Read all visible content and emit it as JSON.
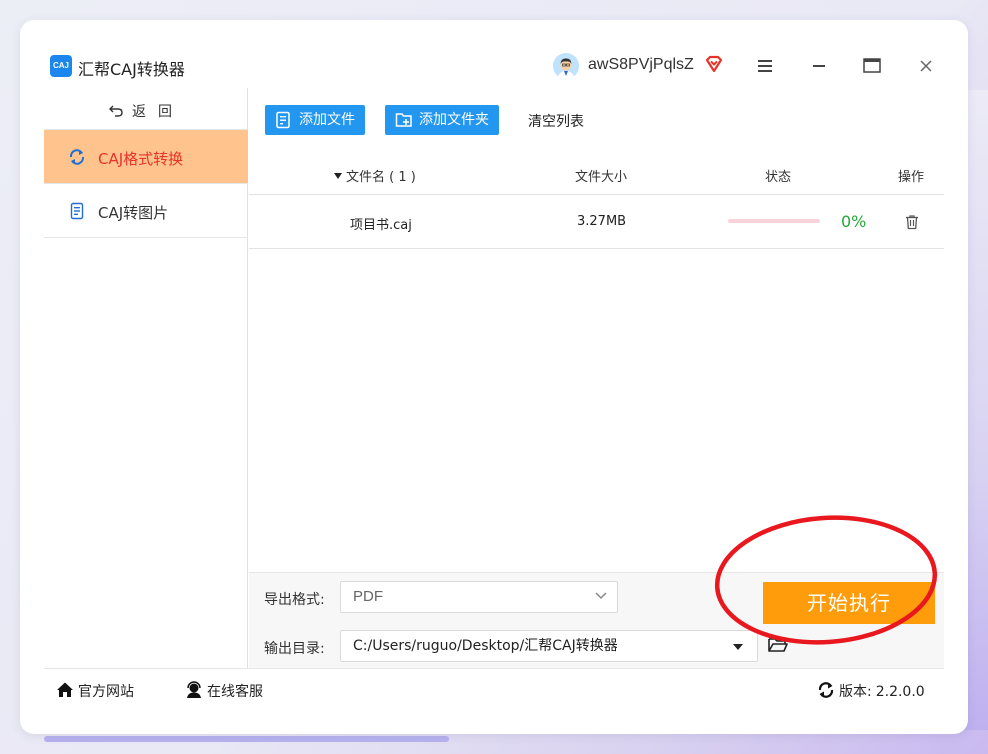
{
  "window": {
    "title": "汇帮CAJ转换器",
    "logo_text": "CAJ",
    "username": "awS8PVjPqlsZ"
  },
  "sidebar": {
    "back_label": "返回",
    "items": [
      {
        "label": "CAJ格式转换",
        "icon": "refresh-icon",
        "active": true
      },
      {
        "label": "CAJ转图片",
        "icon": "document-icon",
        "active": false
      }
    ]
  },
  "toolbar": {
    "add_file": "添加文件",
    "add_folder": "添加文件夹",
    "clear_list": "清空列表"
  },
  "table": {
    "headers": {
      "filename": "文件名 ( 1 )",
      "size": "文件大小",
      "status": "状态",
      "action": "操作"
    },
    "rows": [
      {
        "filename": "项目书.caj",
        "size": "3.27MB",
        "progress": 0,
        "progress_label": "0%"
      }
    ]
  },
  "settings": {
    "format_label": "导出格式:",
    "format_value": "PDF",
    "dir_label": "输出目录:",
    "dir_value": "C:/Users/ruguo/Desktop/汇帮CAJ转换器",
    "start_button": "开始执行"
  },
  "footer": {
    "website": "官方网站",
    "support": "在线客服",
    "version_label": "版本:",
    "version": "2.2.0.0"
  },
  "colors": {
    "accent_blue": "#2396ef",
    "active_nav_bg": "#ffc48e",
    "active_nav_text": "#e8332a",
    "start_button": "#ff9c0c",
    "progress_text": "#26a63a",
    "annotation_red": "#e8181e"
  }
}
